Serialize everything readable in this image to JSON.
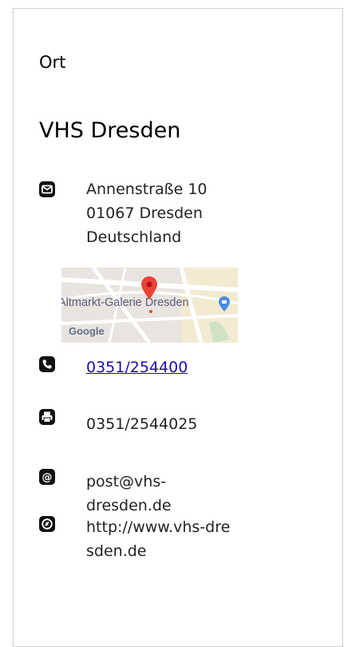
{
  "section": {
    "title": "Ort"
  },
  "org": {
    "name": "VHS Dresden"
  },
  "address": {
    "street": "Annenstraße 10",
    "city": "01067 Dresden",
    "country": "Deutschland"
  },
  "map": {
    "label": "Altmarkt-Galerie Dresden",
    "brand": "Google"
  },
  "contact": {
    "phone": "0351/254400",
    "fax": "0351/2544025",
    "email_line1": "post@vhs-",
    "email_line2": "dresden.de",
    "web_line1": "http://www.vhs-dre",
    "web_line2": "sden.de"
  },
  "icons": {
    "mail": "envelope-icon",
    "phone": "phone-icon",
    "fax": "fax-icon",
    "email": "at-icon",
    "web": "globe-icon"
  }
}
